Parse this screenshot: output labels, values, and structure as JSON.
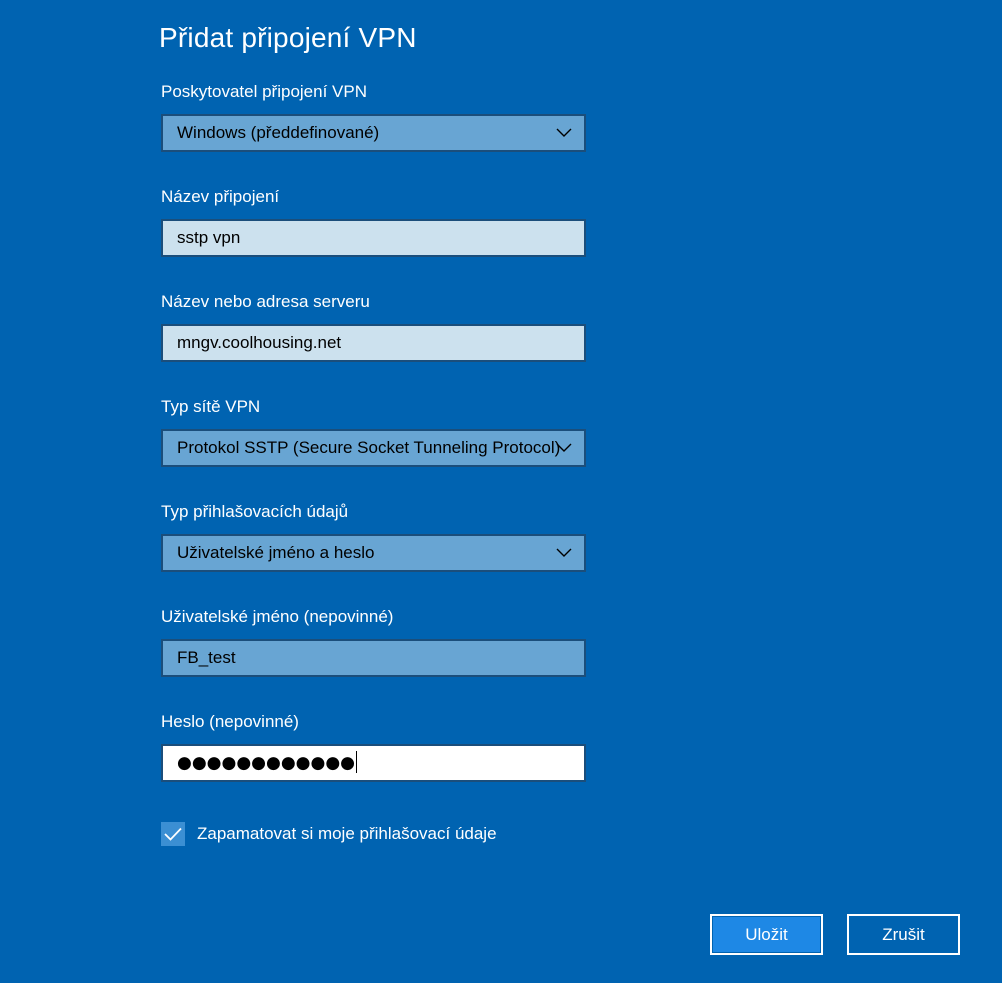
{
  "dialog": {
    "title": "Přidat připojení VPN"
  },
  "fields": {
    "provider": {
      "label": "Poskytovatel připojení VPN",
      "value": "Windows (předdefinované)",
      "icon": "chevron-down-icon"
    },
    "connection_name": {
      "label": "Název připojení",
      "value": "sstp vpn"
    },
    "server": {
      "label": "Název nebo adresa serveru",
      "value": "mngv.coolhousing.net"
    },
    "vpn_type": {
      "label": "Typ sítě VPN",
      "value": "Protokol SSTP (Secure Socket Tunneling Protocol)",
      "icon": "chevron-down-icon"
    },
    "signin_type": {
      "label": "Typ přihlašovacích údajů",
      "value": "Uživatelské jméno a heslo",
      "icon": "chevron-down-icon"
    },
    "username": {
      "label": "Uživatelské jméno (nepovinné)",
      "value": "FB_test"
    },
    "password": {
      "label": "Heslo (nepovinné)",
      "masked_value": "●●●●●●●●●●●●"
    }
  },
  "remember": {
    "label": "Zapamatovat si moje přihlašovací údaje",
    "checked": true,
    "icon": "checkmark-icon"
  },
  "buttons": {
    "save_label": "Uložit",
    "cancel_label": "Zrušit"
  },
  "colors": {
    "background": "#0063b1",
    "select_fill": "#68a5d3",
    "filled_input": "#cce1ee",
    "primary_button": "#1e88e5"
  }
}
